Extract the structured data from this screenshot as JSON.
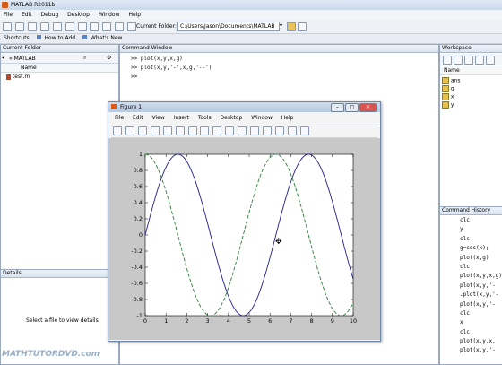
{
  "app": {
    "title": "MATLAB R2011b"
  },
  "menu": [
    "File",
    "Edit",
    "Debug",
    "Desktop",
    "Window",
    "Help"
  ],
  "toolbar": {
    "current_folder_label": "Current Folder:",
    "current_folder_path": "C:\\Users\\Jason\\Documents\\MATLAB"
  },
  "shortcuts": {
    "shortcuts_label": "Shortcuts",
    "how_to_add": "How to Add",
    "whats_new": "What's New"
  },
  "current_folder": {
    "title": "Current Folder",
    "path": "« MATLAB",
    "name_header": "Name",
    "files": [
      "test.m"
    ]
  },
  "details": {
    "title": "Details",
    "hint": "Select a file to view details"
  },
  "command_window": {
    "title": "Command Window",
    "lines": [
      ">> plot(x,y,x,g)",
      ">> plot(x,y,'-',x,g,'--')",
      ">>"
    ]
  },
  "workspace": {
    "title": "Workspace",
    "name_header": "Name",
    "vars": [
      "ans",
      "g",
      "x",
      "y"
    ]
  },
  "history": {
    "title": "Command History",
    "lines": [
      "clc",
      "y",
      "clc",
      "g=cos(x);",
      "plot(x,g)",
      "clc",
      "plot(x,y,x,g)",
      "plot(x,y,'-",
      ".plot(x,y,'-",
      "plot(x,y,'-",
      "clc",
      "x",
      "clc",
      "plot(x,y,x,",
      "plot(x,y,'-"
    ]
  },
  "figure": {
    "title": "Figure 1",
    "menu": [
      "File",
      "Edit",
      "View",
      "Insert",
      "Tools",
      "Desktop",
      "Window",
      "Help"
    ]
  },
  "chart_data": {
    "type": "line",
    "x_range": [
      0,
      10
    ],
    "ylim": [
      -1,
      1
    ],
    "xticks": [
      "0",
      "1",
      "2",
      "3",
      "4",
      "5",
      "6",
      "7",
      "8",
      "9",
      "10"
    ],
    "yticks": [
      "1",
      "0.8",
      "0.6",
      "0.4",
      "0.2",
      "0",
      "-0.2",
      "-0.4",
      "-0.6",
      "-0.8",
      "-1"
    ],
    "series": [
      {
        "function": "sin(x)",
        "style": "solid",
        "color": "#1f1f8f"
      },
      {
        "function": "cos(x)",
        "style": "dashed",
        "color": "#2e7d3a"
      }
    ]
  },
  "watermark": {
    "text": "MATHTUTORDVD.com"
  }
}
